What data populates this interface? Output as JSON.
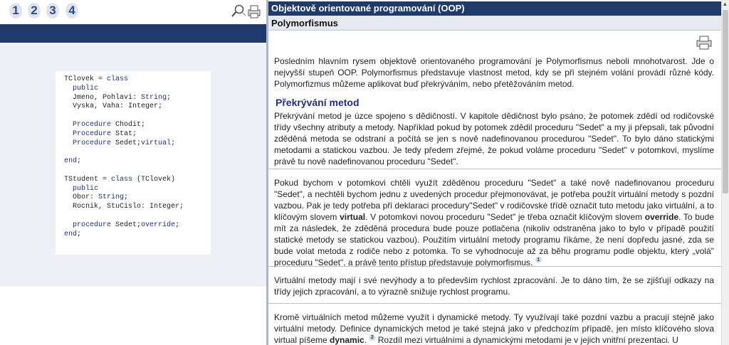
{
  "left": {
    "pages": [
      "1",
      "2",
      "3",
      "4"
    ],
    "icons": {
      "search": "magnifier-icon",
      "print": "print-icon"
    },
    "code": [
      [
        {
          "t": "TClovek = ",
          "k": false
        },
        {
          "t": "class",
          "k": true
        }
      ],
      [
        {
          "t": "  ",
          "k": false
        },
        {
          "t": "public",
          "k": true
        }
      ],
      [
        {
          "t": "  Jmeno, Pohlavi: ",
          "k": false
        },
        {
          "t": "String",
          "k": true
        },
        {
          "t": ";",
          "k": false
        }
      ],
      [
        {
          "t": "  Vyska, Vaha: Integer;",
          "k": false
        }
      ],
      [],
      [
        {
          "t": "  ",
          "k": false
        },
        {
          "t": "Procedure",
          "k": true
        },
        {
          "t": " Chodit;",
          "k": false
        }
      ],
      [
        {
          "t": "  ",
          "k": false
        },
        {
          "t": "Procedure",
          "k": true
        },
        {
          "t": " Stat;",
          "k": false
        }
      ],
      [
        {
          "t": "  ",
          "k": false
        },
        {
          "t": "Procedure",
          "k": true
        },
        {
          "t": " Sedet;",
          "k": false
        },
        {
          "t": "virtual",
          "k": true
        },
        {
          "t": ";",
          "k": false
        }
      ],
      [],
      [
        {
          "t": "end",
          "k": true
        },
        {
          "t": ";",
          "k": false
        }
      ],
      [],
      [
        {
          "t": "TStudent = ",
          "k": false
        },
        {
          "t": "class",
          "k": true
        },
        {
          "t": " (TClovek)",
          "k": false
        }
      ],
      [
        {
          "t": "  ",
          "k": false
        },
        {
          "t": "public",
          "k": true
        }
      ],
      [
        {
          "t": "  Obor: ",
          "k": false
        },
        {
          "t": "String",
          "k": true
        },
        {
          "t": ";",
          "k": false
        }
      ],
      [
        {
          "t": "  Rocnik, StuCislo: Integer;",
          "k": false
        }
      ],
      [],
      [
        {
          "t": "  ",
          "k": false
        },
        {
          "t": "procedure",
          "k": true
        },
        {
          "t": " Sedet;",
          "k": false
        },
        {
          "t": "override",
          "k": true
        },
        {
          "t": ";",
          "k": false
        }
      ],
      [
        {
          "t": "end",
          "k": true
        },
        {
          "t": ";",
          "k": false
        }
      ]
    ]
  },
  "right": {
    "course_title": "Objektově orientované programování (OOP)",
    "chapter_title": "Polymorfismus",
    "section_heading": "Překrývání metod",
    "p1": "Posledním hlavním rysem objektově orientovaného programování je Polymorfismus neboli mnohotvarost. Jde o nejvyšší stupeň OOP. Polymorfismus představuje vlastnost metod, kdy se při stejném volání provádí různé kódy. Polymorfizmus můžeme aplikovat buď překrýváním, nebo přetěžováním metod.",
    "p2": "Překrývání metod je úzce spojeno s dědičností. V kapitole dědičnost bylo psáno, že potomek zdědí od rodičovské třídy všechny atributy a metody. Například pokud by potomek zdědil proceduru \"Sedet\" a my ji přepsali, tak původní zděděná metoda se odstraní a počítá se jen s nově nadefinovanou procedurou \"Sedet\". To bylo dáno statickými metodami a statickou vazbou. Je tedy předem zřejmé, že pokud voláme proceduru \"Sedet\" v potomkovi, myslíme právě tu nově nadefinovanou proceduru \"Sedet\".",
    "p3_a": "Pokud bychom v potomkovi chtěli využít zděděnou proceduru \"Sedet\" a také nově nadefinovanou proceduru \"Sedet\", a nechtěli bychom jednu z uvedených procedur přejmonovávat, je potřeba použít virtuální metody s pozdní vazbou. Pak je tedy potřeba při deklaraci procedury\"Sedet\" v rodičovské třídě označit tuto metodu jako virtuální, a to klíčovým slovem ",
    "p3_kw1": "virtual",
    "p3_b": ". V potomkovi novou proceduru \"Sedet\" je třeba označit klíčovým slovem ",
    "p3_kw2": "override",
    "p3_c": ". To bude mít za následek, že zděděná procedura bude pouze potlačena (nikoliv odstraněna jako to bylo v případě použití statické metody se statickou vazbou). Použitím virtuální metody programu říkáme, že není dopředu jasné, zda se bude volat metoda z rodiče nebo z potomka. To se vyhodnocuje až za běhu programu podle objektu, který „volá\" proceduru \"Sedet\", a právě tento přístup představuje polymorfismus.",
    "fn1": "1",
    "p4": "Virtuální metody mají i své nevýhody a to především rychlost zpracování. Je to dáno tím, že se zjišťují odkazy na třídy jejich zpracování, a to výrazně snižuje rychlost programu.",
    "p5_a": "Kromě virtuálních metod můžeme využít i dynamické metody. Ty využívají také pozdní vazbu a pracují stejně jako virtuální metody. Definice dynamických metod je také stejná jako v předchozím případě, jen místo klíčového slova virtual píšeme ",
    "p5_kw": "dynamic",
    "p5_b": ". ",
    "fn2": "2",
    "p5_c": " Rozdíl mezi virtuálními a dynamickými metodami je v jejich vnitřní prezentaci. U"
  },
  "colors": {
    "navy": "#1f3a6b",
    "keyword": "#1f2e8c",
    "panel_bg": "#eef0f5"
  }
}
